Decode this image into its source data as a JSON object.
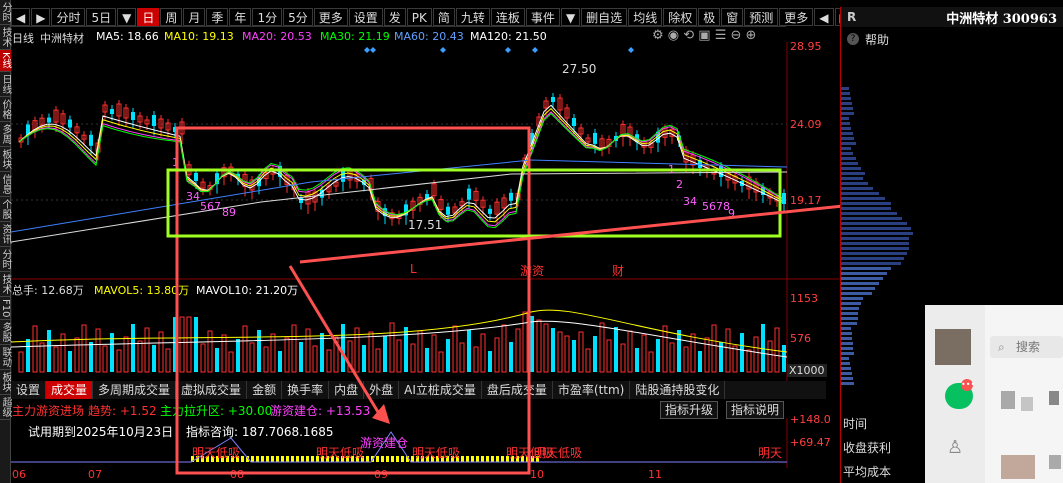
{
  "left_tabs": [
    "分时",
    "技术",
    "K线",
    "日线",
    "价格",
    "多周",
    "板块",
    "信息",
    "个股",
    "资讯",
    "分时",
    "技术",
    "F10",
    "多股",
    "联动",
    "板块",
    "超级"
  ],
  "toolbar": {
    "items_left": [
      "◀",
      "▶",
      "分时",
      "5日",
      "▼",
      "日",
      "周",
      "月",
      "季",
      "年",
      "1分",
      "5分",
      "更多",
      "设置"
    ],
    "items_right": [
      "发",
      "PK",
      "简",
      "九转",
      "连板",
      "事件",
      "▼",
      "删自选",
      "均线",
      "除权",
      "极",
      "窗",
      "预测",
      "更多",
      "◀",
      "▶",
      "▼"
    ]
  },
  "stock": {
    "name": "中洲特材 300963",
    "r": "R"
  },
  "help": {
    "label": "帮助"
  },
  "ma_header": {
    "period": "日线",
    "name": "中洲特材",
    "ma5": "MA5: 18.66",
    "ma10": "MA10: 19.13",
    "ma20": "MA20: 20.53",
    "ma30": "MA30: 21.19",
    "ma60": "MA60: 20.43",
    "ma120": "MA120: 21.50"
  },
  "price_axis": [
    "28.95",
    "24.09",
    "19.17"
  ],
  "annotations": {
    "high": "27.50",
    "low": "17.51"
  },
  "signal_labels": [
    "L",
    "游资",
    "财"
  ],
  "tdseq_a": [
    "1",
    "34",
    "567",
    "89"
  ],
  "tdseq_b": [
    "1",
    "2",
    "34",
    "5678",
    "9"
  ],
  "volume_header": {
    "total": "总手: 12.68万",
    "mavol5": "MAVOL5: 13.80万",
    "mavol10": "MAVOL10: 21.20万"
  },
  "volume_axis": [
    "1153",
    "576",
    "X1000"
  ],
  "bottom_tabs": [
    "设置",
    "成交量",
    "多周期成交量",
    "虚拟成交量",
    "金额",
    "换手率",
    "内盘",
    "外盘",
    "AI立桩成交量",
    "盘后成交量",
    "市盈率(ttm)",
    "陆股通持股变化"
  ],
  "indicator": {
    "title": "主力游资进场",
    "trend": "趋势: +1.52",
    "zhuli": "主力拉升区: +30.00",
    "youzi": "游资建仓: +13.53",
    "upgrade_btn": "指标升级",
    "explain_btn": "指标说明",
    "trial": "试用期到2025年10月23日",
    "consult": "指标咨询: 187.7068.1685",
    "texts": [
      "明天低吸",
      "明天低吸",
      "游资建仓",
      "明天低吸",
      "明天低吸",
      "明天低吸"
    ],
    "axis": [
      "+148.0",
      "+69.47"
    ],
    "right_label": "明天"
  },
  "dates": [
    "06",
    "07",
    "08",
    "09",
    "10",
    "11"
  ],
  "panel_bottom": [
    "时间",
    "收盘获利",
    "平均成本"
  ],
  "chat": {
    "search": "搜索"
  },
  "colors": {
    "up": "#ff3030",
    "down": "#00e0ff",
    "ma5": "#ffffff",
    "ma10": "#ffff00",
    "ma20": "#ff40ff",
    "ma30": "#00ff00",
    "ma60": "#4080ff",
    "ma120": "#ffffff",
    "red_box": "#ff5050",
    "green_box": "#a0ff20"
  }
}
